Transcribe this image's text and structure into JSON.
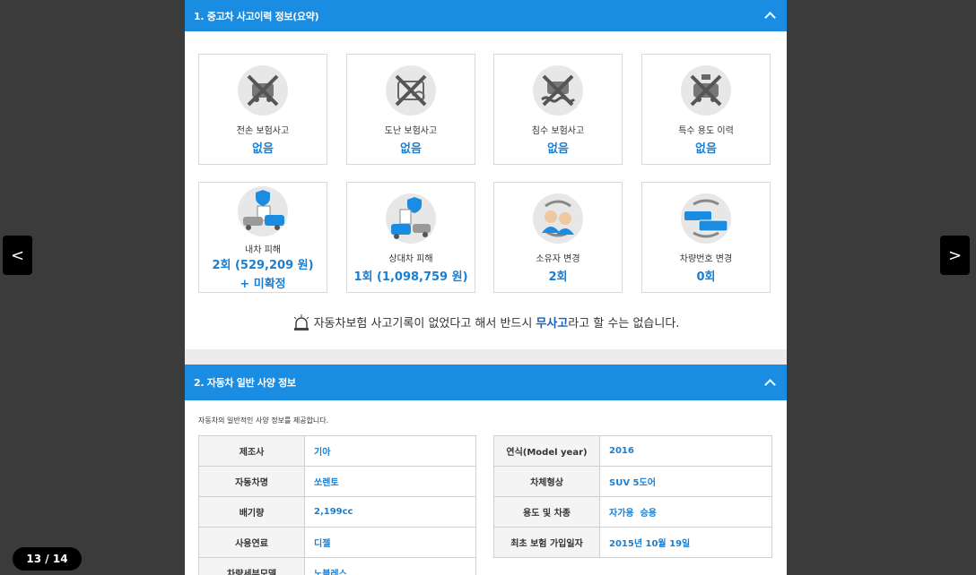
{
  "viewer": {
    "counter": "13 / 14",
    "prev_label": "<",
    "next_label": ">"
  },
  "section1": {
    "title": "1. 중고차 사고이력 정보(요약)",
    "cards": [
      {
        "label": "전손 보험사고",
        "value": "없음",
        "icon": "total-loss-icon"
      },
      {
        "label": "도난 보험사고",
        "value": "없음",
        "icon": "theft-icon"
      },
      {
        "label": "침수 보험사고",
        "value": "없음",
        "icon": "flood-icon"
      },
      {
        "label": "특수 용도 이력",
        "value": "없음",
        "icon": "taxi-icon"
      },
      {
        "label": "내차 피해",
        "value": "2회 (529,209 원) + 미확정",
        "icon": "my-car-damage-icon"
      },
      {
        "label": "상대차 피해",
        "value": "1회 (1,098,759 원)",
        "icon": "other-car-damage-icon"
      },
      {
        "label": "소유자 변경",
        "value": "2회",
        "icon": "owner-change-icon"
      },
      {
        "label": "차량번호 변경",
        "value": "0회",
        "icon": "plate-change-icon"
      }
    ],
    "notice_pre": "자동차보험 사고기록이 없었다고 해서 반드시",
    "notice_hl": "무사고",
    "notice_post": "라고 할 수는 없습니다."
  },
  "section2": {
    "title": "2. 자동차 일반 사양 정보",
    "intro": "자동차의 일반적인 사양 정보를 제공합니다.",
    "left_rows": [
      {
        "key": "제조사",
        "value": "기아"
      },
      {
        "key": "자동차명",
        "value": "쏘렌토"
      },
      {
        "key": "배기량",
        "value": "2,199cc"
      },
      {
        "key": "사용연료",
        "value": "디젤"
      },
      {
        "key": "차량세부모델",
        "value": "노블레스"
      }
    ],
    "right_rows": [
      {
        "key": "연식(Model year)",
        "value": "2016"
      },
      {
        "key": "차체형상",
        "value": "SUV 5도어"
      },
      {
        "key": "용도 및 차종",
        "value": "자가용  승용"
      },
      {
        "key": "최초 보험 가입일자",
        "value": "2015년 10월 19일"
      }
    ]
  },
  "colors": {
    "accent": "#1a8de3",
    "value_blue": "#1a7fd1"
  }
}
